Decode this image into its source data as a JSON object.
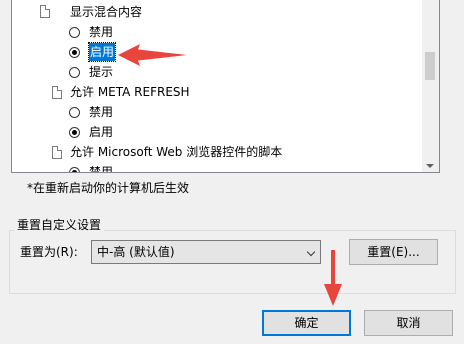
{
  "settings_list": {
    "item1": {
      "title": "显示混合内容",
      "opt_disable": "禁用",
      "opt_enable": "启用",
      "opt_prompt": "提示"
    },
    "item2": {
      "title": "允许 META REFRESH",
      "opt_disable": "禁用",
      "opt_enable": "启用"
    },
    "item3": {
      "title": "允许 Microsoft Web 浏览器控件的脚本",
      "opt_partial": "禁用"
    }
  },
  "restart_note": "*在重新启动你的计算机后生效",
  "reset_group": {
    "title": "重置自定义设置",
    "reset_to_label": "重置为(R):",
    "level_value": "中-高 (默认值)",
    "reset_button": "重置(E)..."
  },
  "footer": {
    "ok": "确定",
    "cancel": "取消"
  },
  "colors": {
    "selection": "#0078d7",
    "annotation_arrow": "#e8453c"
  }
}
